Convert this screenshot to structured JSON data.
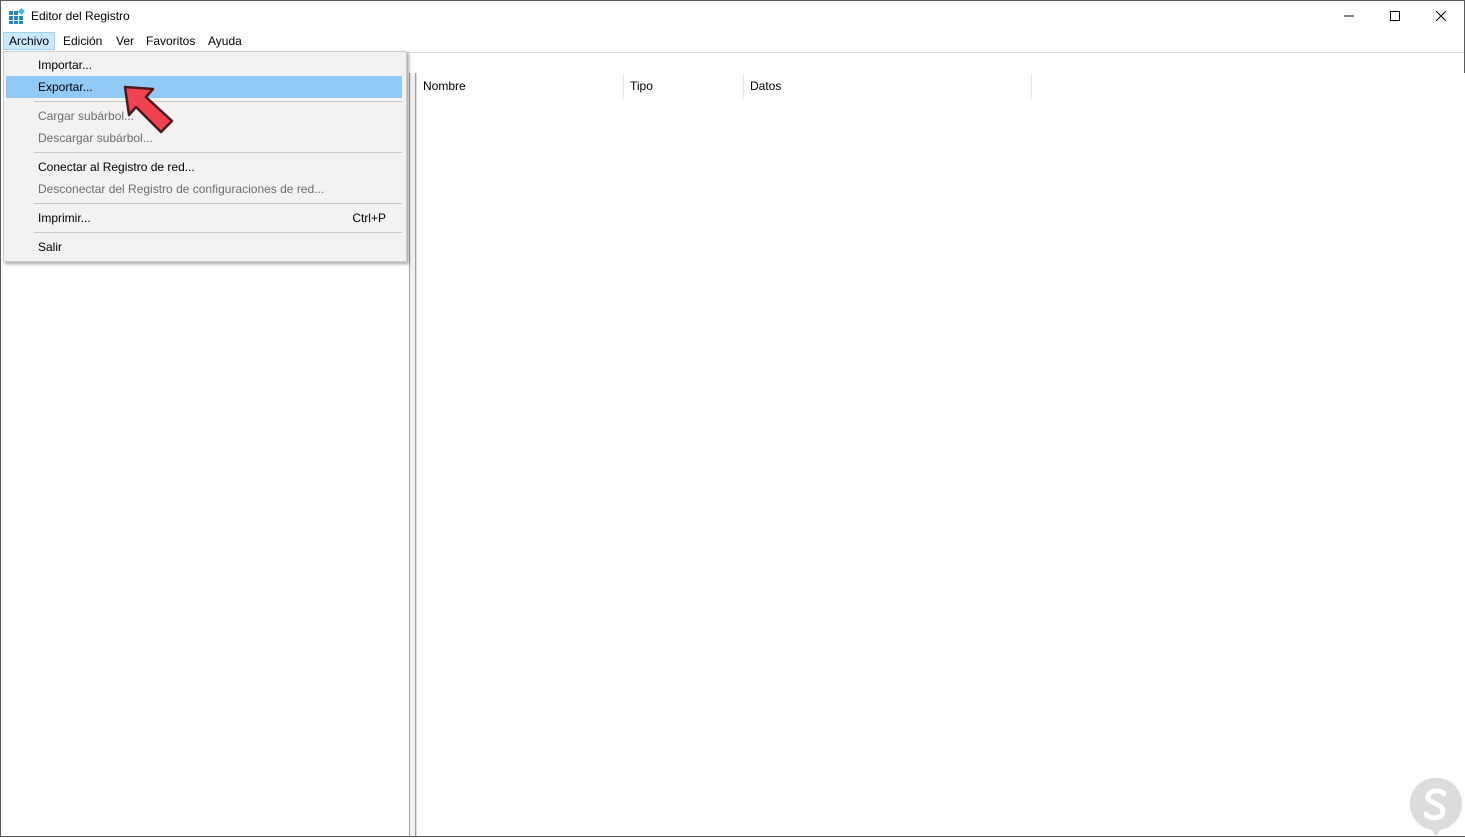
{
  "window": {
    "title": "Editor del Registro",
    "icon": "registry-editor-icon"
  },
  "menubar": {
    "items": [
      "Archivo",
      "Edición",
      "Ver",
      "Favoritos",
      "Ayuda"
    ]
  },
  "file_menu": {
    "importar": "Importar...",
    "exportar": "Exportar...",
    "cargar": "Cargar subárbol...",
    "descargar": "Descargar subárbol...",
    "conectar": "Conectar al Registro de red...",
    "desconectar": "Desconectar del Registro de configuraciones de red...",
    "imprimir": "Imprimir...",
    "imprimir_shortcut": "Ctrl+P",
    "salir": "Salir"
  },
  "list": {
    "columns": [
      "Nombre",
      "Tipo",
      "Datos"
    ]
  },
  "colors": {
    "menu_highlight": "#91c9f7",
    "menubar_active": "#cce8ff",
    "arrow_fill": "#f0434f"
  }
}
